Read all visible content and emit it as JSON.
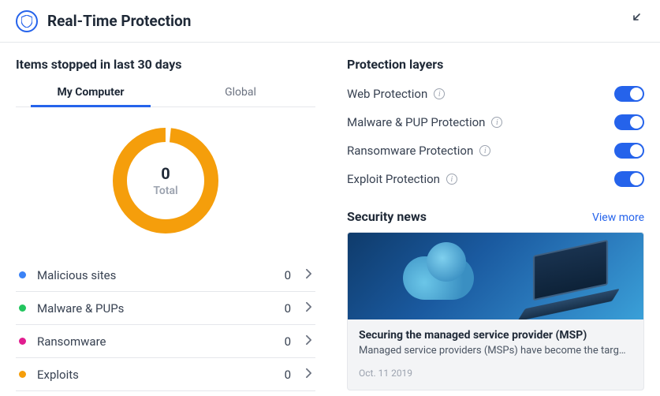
{
  "header": {
    "title": "Real-Time Protection"
  },
  "stats": {
    "title": "Items stopped in last 30 days",
    "tabs": [
      {
        "label": "My Computer",
        "active": true
      },
      {
        "label": "Global",
        "active": false
      }
    ],
    "total_value": "0",
    "total_label": "Total",
    "categories": [
      {
        "label": "Malicious sites",
        "count": "0",
        "color": "#3b82f6"
      },
      {
        "label": "Malware & PUPs",
        "count": "0",
        "color": "#22c55e"
      },
      {
        "label": "Ransomware",
        "count": "0",
        "color": "#e11d8f"
      },
      {
        "label": "Exploits",
        "count": "0",
        "color": "#f59e0b"
      }
    ]
  },
  "chart_data": {
    "type": "pie",
    "title": "Items stopped in last 30 days",
    "categories": [
      "Malicious sites",
      "Malware & PUPs",
      "Ransomware",
      "Exploits"
    ],
    "values": [
      0,
      0,
      0,
      0
    ],
    "total": 0,
    "colors": [
      "#3b82f6",
      "#22c55e",
      "#e11d8f",
      "#f59e0b"
    ],
    "empty_ring_color": "#f59e0b"
  },
  "layers": {
    "title": "Protection layers",
    "items": [
      {
        "label": "Web Protection",
        "on": true
      },
      {
        "label": "Malware & PUP Protection",
        "on": true
      },
      {
        "label": "Ransomware Protection",
        "on": true
      },
      {
        "label": "Exploit Protection",
        "on": true
      }
    ]
  },
  "news": {
    "title": "Security news",
    "view_more": "View more",
    "card": {
      "title": "Securing the managed service provider (MSP)",
      "desc": "Managed service providers (MSPs) have become the targ…",
      "date": "Oct. 11 2019"
    }
  }
}
